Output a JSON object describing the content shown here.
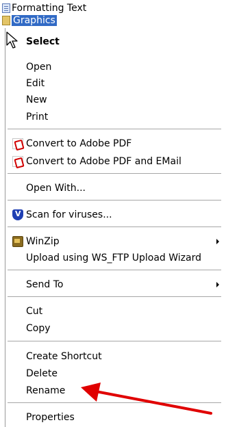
{
  "explorer": {
    "files": [
      {
        "label": "Formatting Text",
        "icon": "word-doc-icon",
        "selected": false
      },
      {
        "label": "Graphics",
        "icon": "folder-icon",
        "selected": true
      }
    ]
  },
  "context_menu": {
    "items": [
      {
        "label": "Select",
        "bold": true
      },
      {
        "label": "Open"
      },
      {
        "label": "Edit"
      },
      {
        "label": "New"
      },
      {
        "label": "Print"
      },
      {
        "label": "Convert to Adobe PDF",
        "icon": "pdf-icon"
      },
      {
        "label": "Convert to Adobe PDF and EMail",
        "icon": "pdf-email-icon"
      },
      {
        "label": "Open With..."
      },
      {
        "label": "Scan for viruses...",
        "icon": "antivirus-shield-icon"
      },
      {
        "label": "WinZip",
        "icon": "winzip-icon",
        "submenu": true
      },
      {
        "label": "Upload using WS_FTP Upload Wizard"
      },
      {
        "label": "Send To",
        "submenu": true
      },
      {
        "label": "Cut"
      },
      {
        "label": "Copy"
      },
      {
        "label": "Create Shortcut"
      },
      {
        "label": "Delete"
      },
      {
        "label": "Rename"
      },
      {
        "label": "Properties"
      }
    ]
  },
  "colors": {
    "selection": "#316ac5",
    "annotation_arrow": "#e00000",
    "separator": "#a6a6a6"
  }
}
